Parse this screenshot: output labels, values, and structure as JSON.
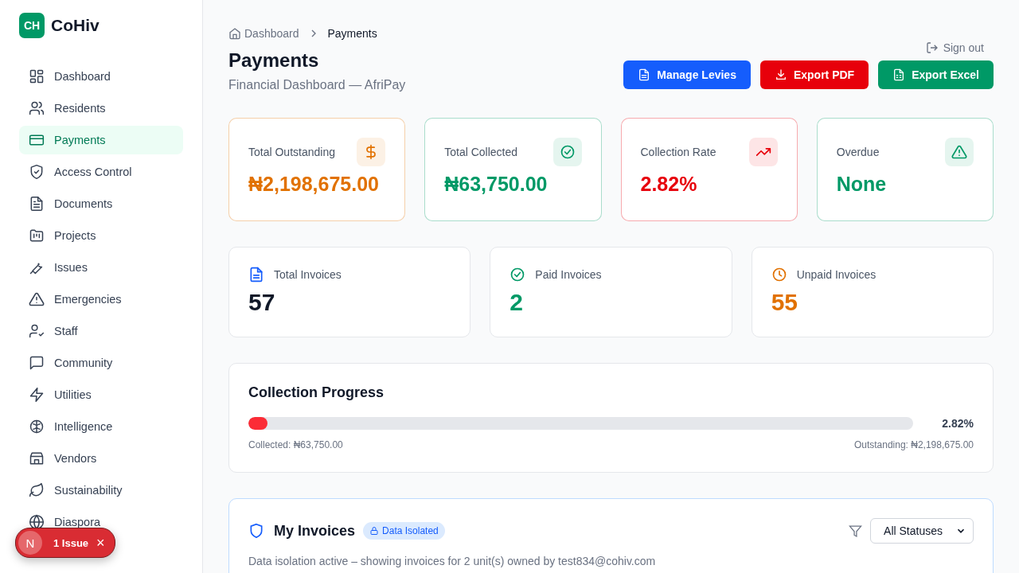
{
  "brand": {
    "logo": "CH",
    "name": "CoHiv"
  },
  "sidebar": {
    "items": [
      {
        "label": "Dashboard",
        "selected": false
      },
      {
        "label": "Residents",
        "selected": false
      },
      {
        "label": "Payments",
        "selected": true
      },
      {
        "label": "Access Control",
        "selected": false
      },
      {
        "label": "Documents",
        "selected": false
      },
      {
        "label": "Projects",
        "selected": false
      },
      {
        "label": "Issues",
        "selected": false
      },
      {
        "label": "Emergencies",
        "selected": false
      },
      {
        "label": "Staff",
        "selected": false
      },
      {
        "label": "Community",
        "selected": false
      },
      {
        "label": "Utilities",
        "selected": false
      },
      {
        "label": "Intelligence",
        "selected": false
      },
      {
        "label": "Vendors",
        "selected": false
      },
      {
        "label": "Sustainability",
        "selected": false
      },
      {
        "label": "Diaspora",
        "selected": false
      }
    ]
  },
  "breadcrumb": [
    "Dashboard",
    "Payments"
  ],
  "sign_out": "Sign out",
  "page": {
    "title": "Payments",
    "subtitle": "Financial Dashboard — AfriPay"
  },
  "actions": [
    {
      "label": "Manage Levies",
      "color": "#155dfc"
    },
    {
      "label": "Export PDF",
      "color": "#e7000b"
    },
    {
      "label": "Export Excel",
      "color": "#009966"
    }
  ],
  "stat_cards": [
    {
      "label": "Total Outstanding",
      "value": "₦2,198,675.00",
      "color": "#e17100"
    },
    {
      "label": "Total Collected",
      "value": "₦63,750.00",
      "color": "#009966"
    },
    {
      "label": "Collection Rate",
      "value": "2.82%",
      "color": "#e7000b"
    },
    {
      "label": "Overdue",
      "value": "None",
      "color": "#009966"
    }
  ],
  "invoice_cards": [
    {
      "label": "Total Invoices",
      "value": "57",
      "color": "#155dfc"
    },
    {
      "label": "Paid Invoices",
      "value": "2",
      "color": "#009966"
    },
    {
      "label": "Unpaid Invoices",
      "value": "55",
      "color": "#e17100"
    }
  ],
  "progress": {
    "title": "Collection Progress",
    "level": 0.0282,
    "reading": "2.82%",
    "collected": "Collected: ₦63,750.00",
    "outstanding": "Outstanding: ₦2,198,675.00"
  },
  "invoices": {
    "title": "My Invoices",
    "badge": "Data Isolated",
    "filter": "All Statuses",
    "note": "Data isolation active – showing invoices for 2 unit(s) owned by test834@cohiv.com"
  },
  "toast": {
    "avatar": "N",
    "label": "1 Issue",
    "close": "×"
  }
}
